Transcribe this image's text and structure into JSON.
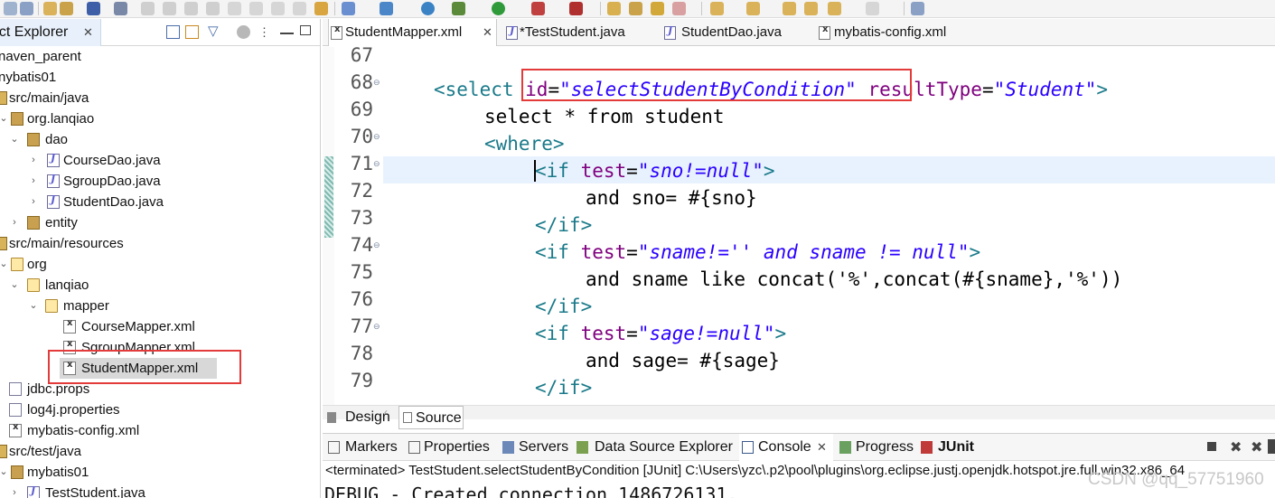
{
  "explorer": {
    "title": "ect Explorer",
    "items": [
      {
        "label": "naven_parent"
      },
      {
        "label": "nybatis01"
      },
      {
        "label": "src/main/java"
      },
      {
        "label": "org.lanqiao"
      },
      {
        "label": "dao"
      },
      {
        "label": "CourseDao.java"
      },
      {
        "label": "SgroupDao.java"
      },
      {
        "label": "StudentDao.java"
      },
      {
        "label": "entity"
      },
      {
        "label": "src/main/resources"
      },
      {
        "label": "org"
      },
      {
        "label": "lanqiao"
      },
      {
        "label": "mapper"
      },
      {
        "label": "CourseMapper.xml"
      },
      {
        "label": "SgroupMapper.xml"
      },
      {
        "label": "StudentMapper.xml"
      },
      {
        "label": "jdbc.props"
      },
      {
        "label": "log4j.properties"
      },
      {
        "label": "mybatis-config.xml"
      },
      {
        "label": "src/test/java"
      },
      {
        "label": "mybatis01"
      },
      {
        "label": "TestStudent.java"
      }
    ]
  },
  "editor": {
    "tabs": [
      {
        "label": "StudentMapper.xml",
        "active": true
      },
      {
        "label": "*TestStudent.java"
      },
      {
        "label": "StudentDao.java"
      },
      {
        "label": "mybatis-config.xml"
      }
    ],
    "lines": [
      {
        "num": "67"
      },
      {
        "num": "68",
        "t1": "<select ",
        "a1": "id",
        "e1": "=",
        "s1": "\"selectStudentByCondition\"",
        "sp": " ",
        "a2": "resultType",
        "e2": "=",
        "s2": "\"Student\"",
        "t2": ">"
      },
      {
        "num": "69",
        "text": "select * from student"
      },
      {
        "num": "70",
        "tag": "<where>"
      },
      {
        "num": "71",
        "t1": "<if ",
        "a1": "test",
        "e1": "=",
        "s1": "\"sno!=null\"",
        "t2": ">"
      },
      {
        "num": "72",
        "text": "and sno= #{sno}"
      },
      {
        "num": "73",
        "tag": "</if>"
      },
      {
        "num": "74",
        "t1": "<if ",
        "a1": "test",
        "e1": "=",
        "s1": "\"sname!='' and sname != null\"",
        "t2": ">"
      },
      {
        "num": "75",
        "text": "and sname like concat('%',concat(#{sname},'%'))"
      },
      {
        "num": "76",
        "tag": "</if>"
      },
      {
        "num": "77",
        "t1": "<if ",
        "a1": "test",
        "e1": "=",
        "s1": "\"sage!=null\"",
        "t2": ">"
      },
      {
        "num": "78",
        "text": "and sage= #{sage}"
      },
      {
        "num": "79",
        "tag": "</if>"
      }
    ],
    "design_tab": "Design",
    "source_tab": "Source"
  },
  "bottom": {
    "tabs": [
      {
        "label": "Markers"
      },
      {
        "label": "Properties"
      },
      {
        "label": "Servers"
      },
      {
        "label": "Data Source Explorer"
      },
      {
        "label": "Console"
      },
      {
        "label": "Progress"
      },
      {
        "label": "JUnit"
      }
    ],
    "status": "<terminated> TestStudent.selectStudentByCondition [JUnit] C:\\Users\\yzc\\.p2\\pool\\plugins\\org.eclipse.justj.openjdk.hotspot.jre.full.win32.x86_64",
    "console_line": "DEBUG - Created connection 1486726131.",
    "watermark": "CSDN @qq_57751960"
  },
  "colors": {
    "highlight": "#e33a3a",
    "tag": "#1a7a8a",
    "attr": "#7f007f",
    "string": "#2a00ff"
  }
}
